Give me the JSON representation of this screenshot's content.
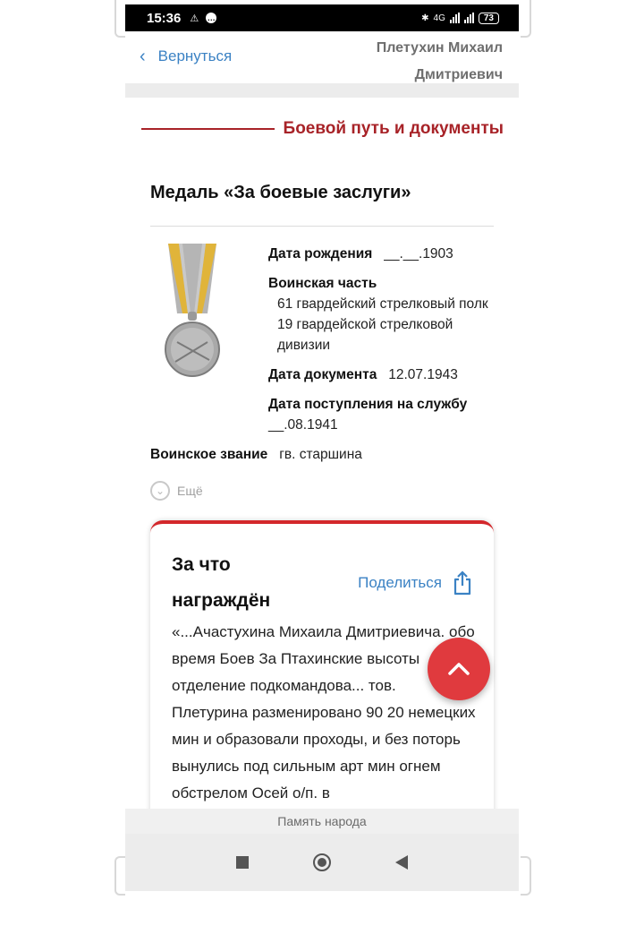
{
  "status_bar": {
    "time": "15:36",
    "network": "4G",
    "battery": "73"
  },
  "header": {
    "back_label": "Вернуться",
    "person_name_line1": "Плетухин Михаил",
    "person_name_line2": "Дмитриевич"
  },
  "section": {
    "title": "Боевой путь и документы"
  },
  "award": {
    "title": "Медаль «За боевые заслуги»",
    "birth_date_label": "Дата рождения",
    "birth_date_value": "__.__.1903",
    "unit_label": "Воинская часть",
    "unit_value": "61 гвардейский стрелковый полк 19 гвардейской стрелковой дивизии",
    "doc_date_label": "Дата документа",
    "doc_date_value": "12.07.1943",
    "service_start_label": "Дата поступления на службу",
    "service_start_value": "__.08.1941",
    "rank_label": "Воинское звание",
    "rank_value": "гв. старшина",
    "more_label": "Ещё"
  },
  "card": {
    "title": "За что награждён",
    "share_label": "Поделиться",
    "text": "«...Ачастухина Михаила Дмитриевича. обо время Боев За Птахинские высоты отделение подкомандова... тов. Плетурина разменировано 90 20 немецких мин и образовали проходы, и без поторь вынулись под сильным арт мин огнем обстрелом Осей о/п. в"
  },
  "footer": {
    "label": "Память народа"
  },
  "colors": {
    "accent_red": "#a82328",
    "link_blue": "#3b82c4",
    "fab_red": "#e03a3e"
  }
}
